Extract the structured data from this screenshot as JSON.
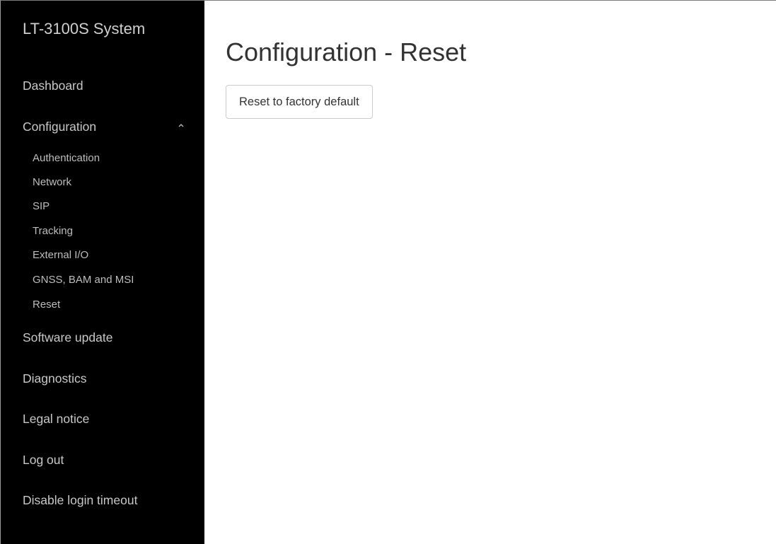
{
  "sidebar": {
    "brand": "LT-3100S System",
    "dashboard": "Dashboard",
    "configuration": {
      "label": "Configuration",
      "expanded": true,
      "toggle_icon": "chevron-up-icon",
      "items": [
        {
          "label": "Authentication"
        },
        {
          "label": "Network"
        },
        {
          "label": "SIP"
        },
        {
          "label": "Tracking"
        },
        {
          "label": "External I/O"
        },
        {
          "label": "GNSS, BAM and MSI"
        },
        {
          "label": "Reset"
        }
      ]
    },
    "software_update": "Software update",
    "diagnostics": "Diagnostics",
    "legal_notice": "Legal notice",
    "log_out": "Log out",
    "disable_login_timeout": "Disable login timeout"
  },
  "main": {
    "title": "Configuration - Reset",
    "reset_button_label": "Reset to factory default"
  },
  "colors": {
    "sidebar_background": "#000000",
    "sidebar_text": "#c8c8c8",
    "main_background": "#ffffff",
    "title_text": "#333333",
    "button_border": "#cccccc"
  }
}
